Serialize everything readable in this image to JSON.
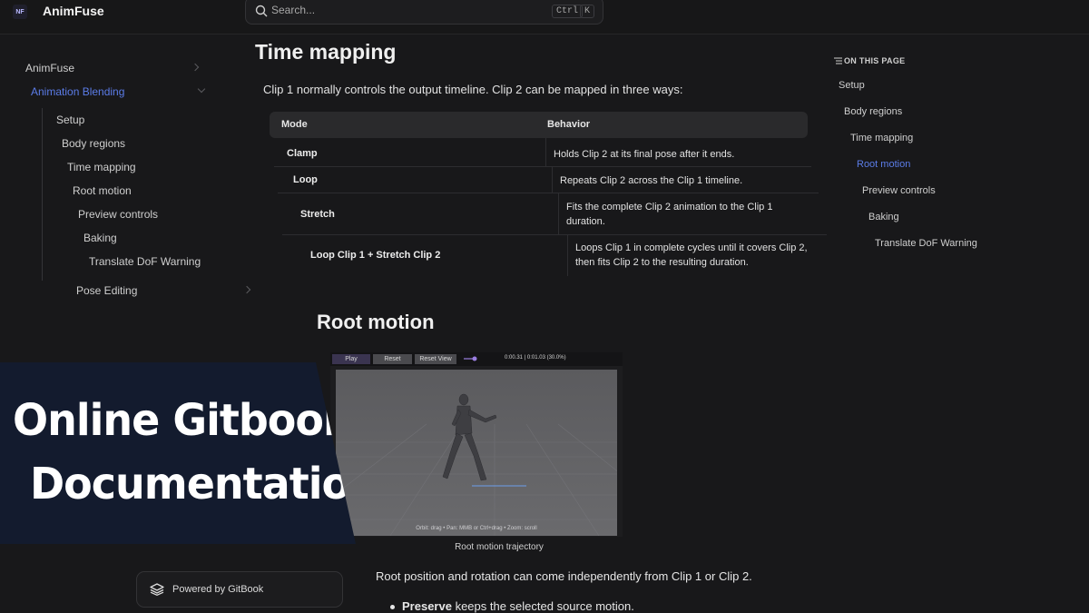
{
  "header": {
    "logo_text": "NF",
    "brand": "AnimFuse",
    "search_placeholder": "Search...",
    "shortcut_ctrl": "Ctrl",
    "shortcut_key": "K"
  },
  "sidebar": {
    "items": [
      {
        "label": "AnimFuse"
      },
      {
        "label": "Animation Blending",
        "active": true
      },
      {
        "label": "Setup"
      },
      {
        "label": "Body regions"
      },
      {
        "label": "Time mapping"
      },
      {
        "label": "Root motion"
      },
      {
        "label": "Preview controls"
      },
      {
        "label": "Baking"
      },
      {
        "label": "Translate DoF Warning"
      },
      {
        "label": "Pose Editing"
      }
    ]
  },
  "main": {
    "title": "Time mapping",
    "intro": "Clip 1 normally controls the output timeline. Clip 2 can be mapped in three ways:",
    "table": {
      "headers": [
        "Mode",
        "Behavior"
      ],
      "rows": [
        {
          "mode": "Clamp",
          "behavior": "Holds Clip 2 at its final pose after it ends."
        },
        {
          "mode": "Loop",
          "behavior": "Repeats Clip 2 across the Clip 1 timeline."
        },
        {
          "mode": "Stretch",
          "behavior": "Fits the complete Clip 2 animation to the Clip 1 duration."
        },
        {
          "mode": "Loop Clip 1 + Stretch Clip 2",
          "behavior": "Loops Clip 1 in complete cycles until it covers Clip 2, then fits Clip 2 to the resulting duration."
        }
      ]
    },
    "section_title": "Root motion",
    "viewer": {
      "play": "Play",
      "reset": "Reset",
      "reset_view": "Reset View",
      "time": "0:00.31 | 0:01.03 (30.0%)",
      "hint": "Orbit: drag  •  Pan: MMB or Ctrl+drag  •  Zoom: scroll"
    },
    "caption": "Root motion trajectory",
    "paragraph": "Root position and rotation can come independently from Clip 1 or Clip 2.",
    "bullet_bold": "Preserve",
    "bullet_rest": " keeps the selected source motion."
  },
  "toc": {
    "title": "ON THIS PAGE",
    "items": [
      {
        "label": "Setup"
      },
      {
        "label": "Body regions"
      },
      {
        "label": "Time mapping"
      },
      {
        "label": "Root motion",
        "active": true
      },
      {
        "label": "Preview controls"
      },
      {
        "label": "Baking"
      },
      {
        "label": "Translate DoF Warning"
      }
    ]
  },
  "banner": {
    "line1": "Online Gitbook",
    "line2": "Documentation"
  },
  "footer": {
    "powered": "Powered by GitBook"
  }
}
